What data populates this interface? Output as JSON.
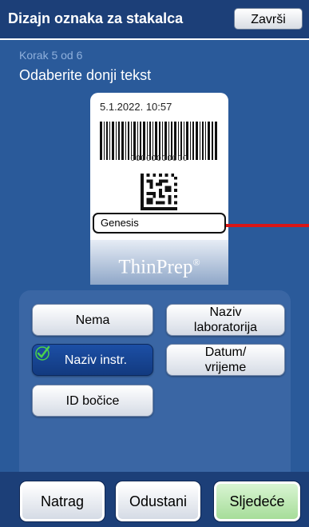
{
  "header": {
    "title": "Dizajn oznaka za stakalca",
    "done_label": "Završi"
  },
  "step": "Korak 5 od 6",
  "instruction": "Odaberite donji tekst",
  "label": {
    "date": "5.1.2022. 10:57",
    "barcode_number": "00000000000",
    "bottom_text": "Genesis",
    "brand": "ThinPrep",
    "brand_mark": "®"
  },
  "options": {
    "none": "Nema",
    "lab_name": "Naziv laboratorija",
    "instr_name": "Naziv instr.",
    "datetime": "Datum/ vrijeme",
    "vial_id": "ID bočice",
    "selected": "instr_name"
  },
  "nav": {
    "back": "Natrag",
    "cancel": "Odustani",
    "next": "Sljedeće"
  },
  "colors": {
    "header": "#1c3f78",
    "background": "#2a5a9a",
    "selected": "#1c4fa6",
    "next": "#a6dd99",
    "pointer": "#d91616"
  }
}
